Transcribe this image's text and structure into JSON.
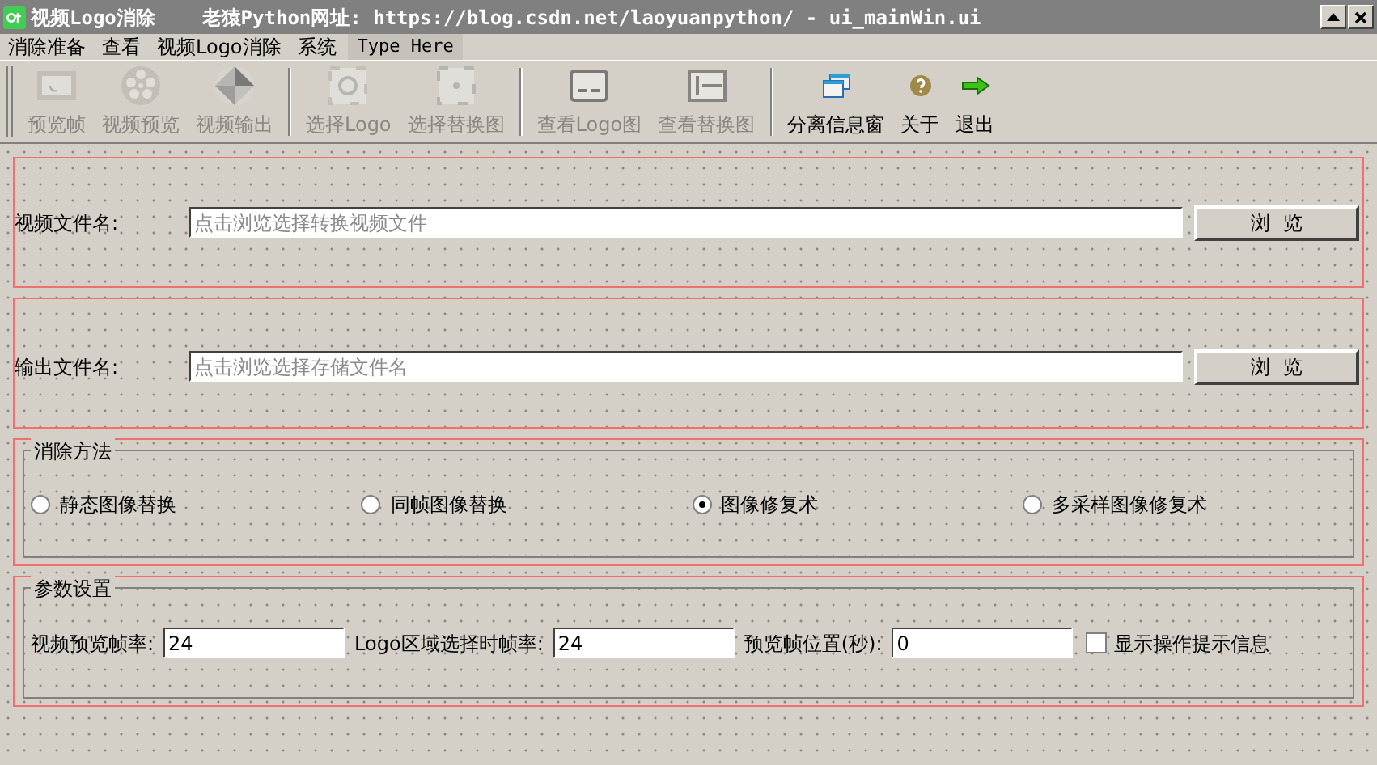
{
  "window": {
    "title": "视频Logo消除    老猿Python网址: https://blog.csdn.net/laoyuanpython/ - ui_mainWin.ui"
  },
  "menu": [
    {
      "label": "消除准备",
      "kind": "menu"
    },
    {
      "label": "查看",
      "kind": "menu"
    },
    {
      "label": "视频Logo消除",
      "kind": "menu"
    },
    {
      "label": "系统",
      "kind": "menu"
    },
    {
      "label": "Type Here",
      "kind": "placeholder"
    }
  ],
  "toolbar": [
    [
      {
        "label": "预览帧",
        "disabled": true
      },
      {
        "label": "视频预览",
        "disabled": true
      },
      {
        "label": "视频输出",
        "disabled": true
      }
    ],
    [
      {
        "label": "选择Logo",
        "disabled": true
      },
      {
        "label": "选择替换图",
        "disabled": true
      }
    ],
    [
      {
        "label": "查看Logo图",
        "disabled": true
      },
      {
        "label": "查看替换图",
        "disabled": true
      }
    ],
    [
      {
        "label": "分离信息窗",
        "disabled": false
      },
      {
        "label": "关于",
        "disabled": false
      },
      {
        "label": "退出",
        "disabled": false
      }
    ]
  ],
  "file_rows": [
    {
      "label": "视频文件名:",
      "placeholder": "点击浏览选择转换视频文件",
      "button": "浏  览"
    },
    {
      "label": "输出文件名:",
      "placeholder": "点击浏览选择存储文件名",
      "button": "浏  览"
    }
  ],
  "method": {
    "title": "消除方法",
    "options": [
      {
        "label": "静态图像替换",
        "selected": false
      },
      {
        "label": "同帧图像替换",
        "selected": false
      },
      {
        "label": "图像修复术",
        "selected": true
      },
      {
        "label": "多采样图像修复术",
        "selected": false
      }
    ]
  },
  "params": {
    "title": "参数设置",
    "fields": [
      {
        "label": "视频预览帧率:",
        "value": "24"
      },
      {
        "label": "Logo区域选择时帧率:",
        "value": "24"
      },
      {
        "label": "预览帧位置(秒):",
        "value": "0"
      }
    ],
    "checkbox": {
      "label": "显示操作提示信息",
      "checked": false
    }
  }
}
